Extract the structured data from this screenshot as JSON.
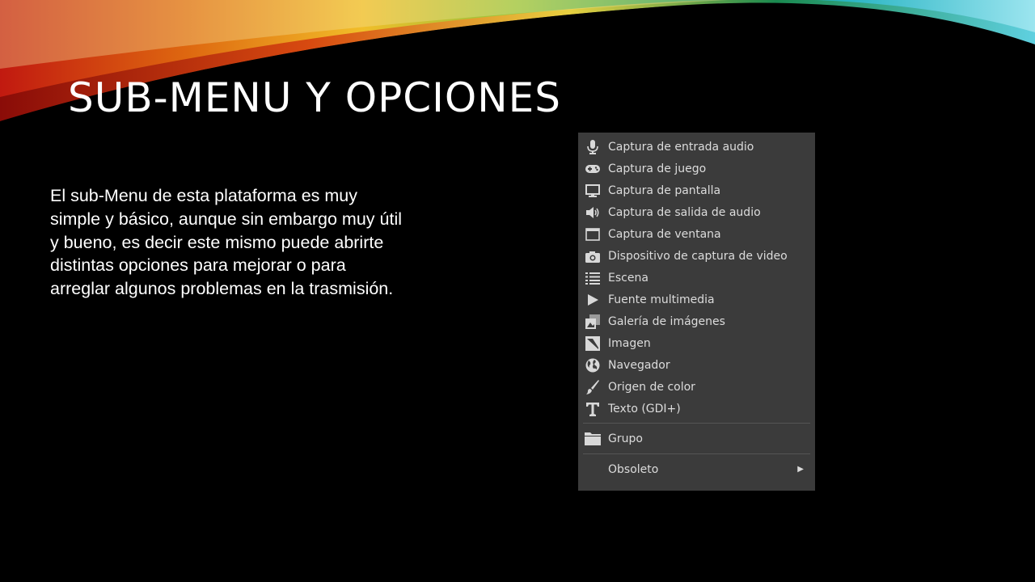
{
  "slide": {
    "title": "SUB-MENU Y OPCIONES",
    "body": "El sub-Menu de esta plataforma es muy simple y básico, aunque sin embargo muy útil y bueno, es decir este mismo puede abrirte distintas opciones para mejorar o para arreglar algunos problemas en la trasmisión."
  },
  "menu": {
    "items": [
      {
        "label": "Captura de entrada audio",
        "icon": "microphone-icon"
      },
      {
        "label": "Captura de juego",
        "icon": "gamepad-icon"
      },
      {
        "label": "Captura de pantalla",
        "icon": "monitor-icon"
      },
      {
        "label": "Captura de salida de audio",
        "icon": "speaker-icon"
      },
      {
        "label": "Captura de ventana",
        "icon": "window-icon"
      },
      {
        "label": "Dispositivo de captura de video",
        "icon": "camera-icon"
      },
      {
        "label": "Escena",
        "icon": "list-icon"
      },
      {
        "label": "Fuente multimedia",
        "icon": "play-icon"
      },
      {
        "label": "Galería de imágenes",
        "icon": "gallery-icon"
      },
      {
        "label": "Imagen",
        "icon": "image-icon"
      },
      {
        "label": "Navegador",
        "icon": "globe-icon"
      },
      {
        "label": "Origen de color",
        "icon": "brush-icon"
      },
      {
        "label": "Texto (GDI+)",
        "icon": "text-icon"
      }
    ],
    "group": {
      "label": "Grupo",
      "icon": "folder-icon"
    },
    "obsolete": {
      "label": "Obsoleto",
      "icon": "chevron-right-icon"
    }
  },
  "colors": {
    "background": "#000000",
    "menu_bg": "#3b3b3b",
    "menu_text": "#dcdcdc"
  }
}
